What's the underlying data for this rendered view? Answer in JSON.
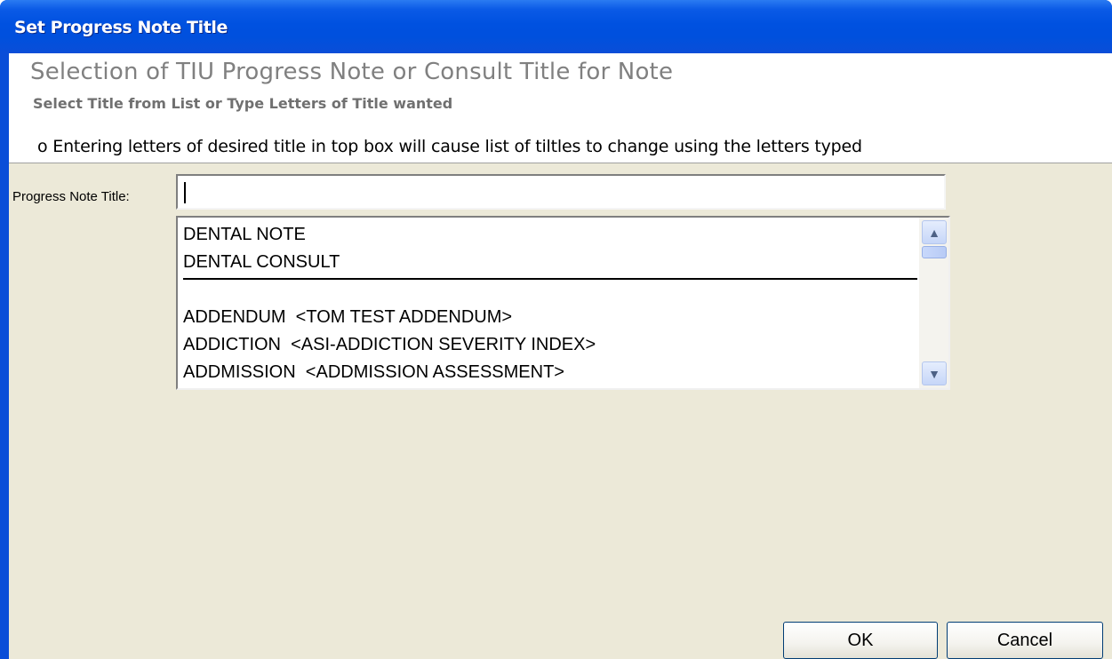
{
  "window": {
    "title": "Set Progress Note Title"
  },
  "header": {
    "title": "Selection of TIU Progress Note or Consult Title for Note",
    "subtitle": "Select Title from List or Type Letters of Title wanted",
    "info": "o Entering letters of desired title in top box will cause list of tiltles to change using the letters typed"
  },
  "form": {
    "label": "Progress Note Title:",
    "input_value": ""
  },
  "list": {
    "items": [
      "DENTAL NOTE",
      "DENTAL CONSULT",
      "ADDENDUM  <TOM TEST ADDENDUM>",
      "ADDICTION  <ASI-ADDICTION SEVERITY INDEX>",
      "ADDMISSION  <ADDMISSION ASSESSMENT>"
    ]
  },
  "buttons": {
    "ok": "OK",
    "cancel": "Cancel"
  },
  "icons": {
    "scroll_up": "chevron-up-icon",
    "scroll_down": "chevron-down-icon"
  },
  "colors": {
    "titlebar": "#0a4ed8",
    "client_background": "#ece9d8",
    "header_title": "#808080"
  }
}
